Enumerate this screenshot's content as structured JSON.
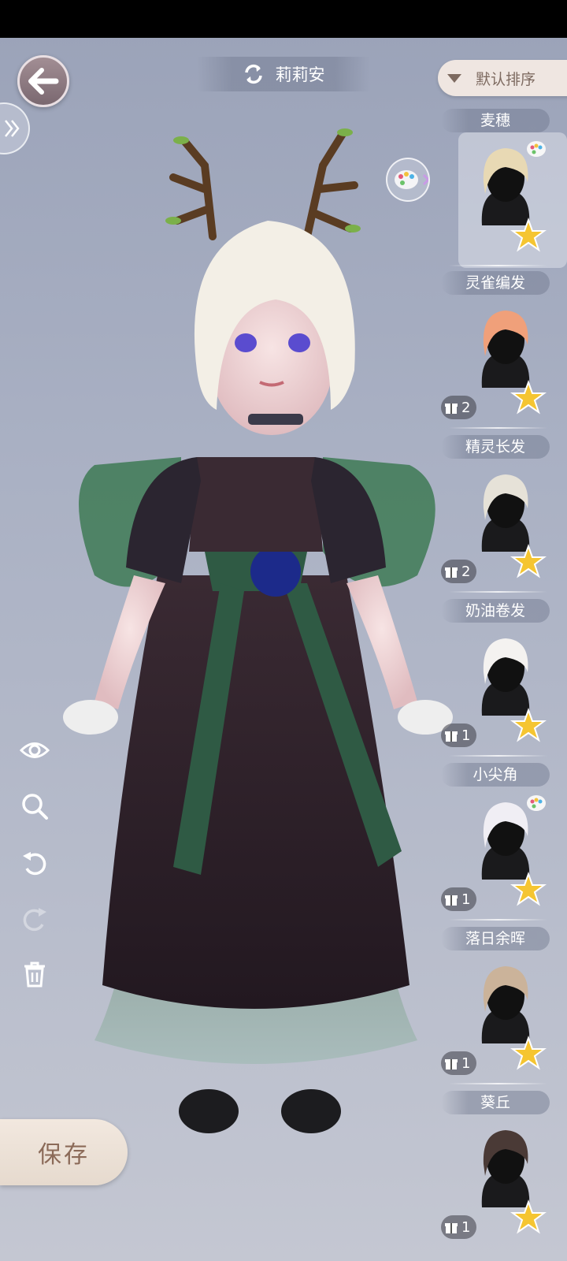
{
  "header": {
    "character_name": "莉莉安",
    "sort_label": "默认排序"
  },
  "icons": {
    "back": "back-arrow-icon",
    "expand": "double-chevron-right-icon",
    "swap": "swap-icon",
    "palette": "palette-icon",
    "eye": "eye-icon",
    "zoom": "zoom-icon",
    "undo": "undo-icon",
    "redo": "redo-icon",
    "trash": "trash-icon",
    "star": "star-icon",
    "gift": "gift-icon"
  },
  "save": {
    "label": "保存"
  },
  "hair_list": [
    {
      "name": "麦穗",
      "count": "",
      "has_palette": true,
      "selected": true,
      "color": "#e8d9b4"
    },
    {
      "name": "灵雀编发",
      "count": "2",
      "has_palette": false,
      "selected": false,
      "color": "#f0a07a"
    },
    {
      "name": "精灵长发",
      "count": "2",
      "has_palette": false,
      "selected": false,
      "color": "#e6e2d8"
    },
    {
      "name": "奶油卷发",
      "count": "1",
      "has_palette": false,
      "selected": false,
      "color": "#f4f2f0"
    },
    {
      "name": "小尖角",
      "count": "1",
      "has_palette": true,
      "selected": false,
      "color": "#f0eef4"
    },
    {
      "name": "落日余晖",
      "count": "1",
      "has_palette": false,
      "selected": false,
      "color": "#cbb39a"
    },
    {
      "name": "葵丘",
      "count": "1",
      "has_palette": false,
      "selected": false,
      "color": "#4a3a36"
    }
  ],
  "colors": {
    "accent": "#f5c531",
    "save_text": "#8b6a58",
    "sort_text": "#7d6a60"
  }
}
